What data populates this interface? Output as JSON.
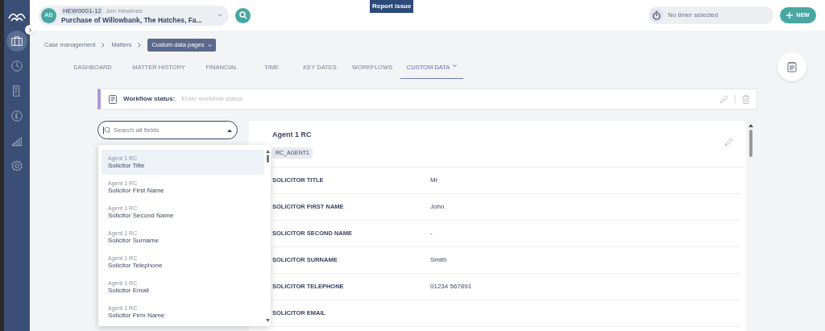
{
  "sidebar": {
    "items": [
      {
        "selected": true
      },
      {
        "selected": false
      },
      {
        "selected": false
      },
      {
        "selected": false
      },
      {
        "selected": false
      },
      {
        "selected": false
      }
    ]
  },
  "header": {
    "avatar": "AB",
    "matter_ref": "HEW0001-12",
    "client": "Jon Hewines",
    "matter_title": "Purchase of Willowbank, The Hatches, Fa...",
    "report_issue": "Report issue",
    "timer": "No timer selected",
    "new_button": "NEW"
  },
  "breadcrumbs": [
    {
      "label": "Case management",
      "kind": "link"
    },
    {
      "label": "Matters",
      "kind": "link"
    },
    {
      "label": "Custom data pages",
      "kind": "dropdown"
    }
  ],
  "tabs": [
    {
      "label": "DASHBOARD",
      "selected": false
    },
    {
      "label": "MATTER HISTORY",
      "selected": false
    },
    {
      "label": "FINANCIAL",
      "selected": false
    },
    {
      "label": "TIME",
      "selected": false
    },
    {
      "label": "KEY DATES",
      "selected": false
    },
    {
      "label": "WORKFLOWS",
      "selected": false
    },
    {
      "label": "CUSTOM DATA",
      "selected": true
    }
  ],
  "workflow_status": {
    "label": "Workflow status:",
    "placeholder": "Enter workflow status"
  },
  "field_search": {
    "placeholder": "Search all fields",
    "expanded": true
  },
  "dropdown_items": [
    {
      "group": "Agent 1 RC",
      "label": "Solicitor Title",
      "selected": true
    },
    {
      "group": "Agent 1 RC",
      "label": "Solicitor First Name",
      "selected": false
    },
    {
      "group": "Agent 1 RC",
      "label": "Solicitor Second Name",
      "selected": false
    },
    {
      "group": "Agent 1 RC",
      "label": "Solicitor Surname",
      "selected": false
    },
    {
      "group": "Agent 1 RC",
      "label": "Solicitor Telephone",
      "selected": false
    },
    {
      "group": "Agent 1 RC",
      "label": "Solicitor Email",
      "selected": false
    },
    {
      "group": "Agent 1 RC",
      "label": "Solicitor Firm Name",
      "selected": false
    }
  ],
  "card": {
    "title": "Agent 1 RC",
    "code": "RC_AGENT1",
    "rows": [
      {
        "label": "SOLICITOR TITLE",
        "value": "Mr"
      },
      {
        "label": "SOLICITOR FIRST NAME",
        "value": "John"
      },
      {
        "label": "SOLICITOR SECOND NAME",
        "value": "-"
      },
      {
        "label": "SOLICITOR SURNAME",
        "value": "Smith"
      },
      {
        "label": "SOLICITOR TELEPHONE",
        "value": "01234 567891"
      },
      {
        "label": "SOLICITOR EMAIL"
      }
    ]
  }
}
